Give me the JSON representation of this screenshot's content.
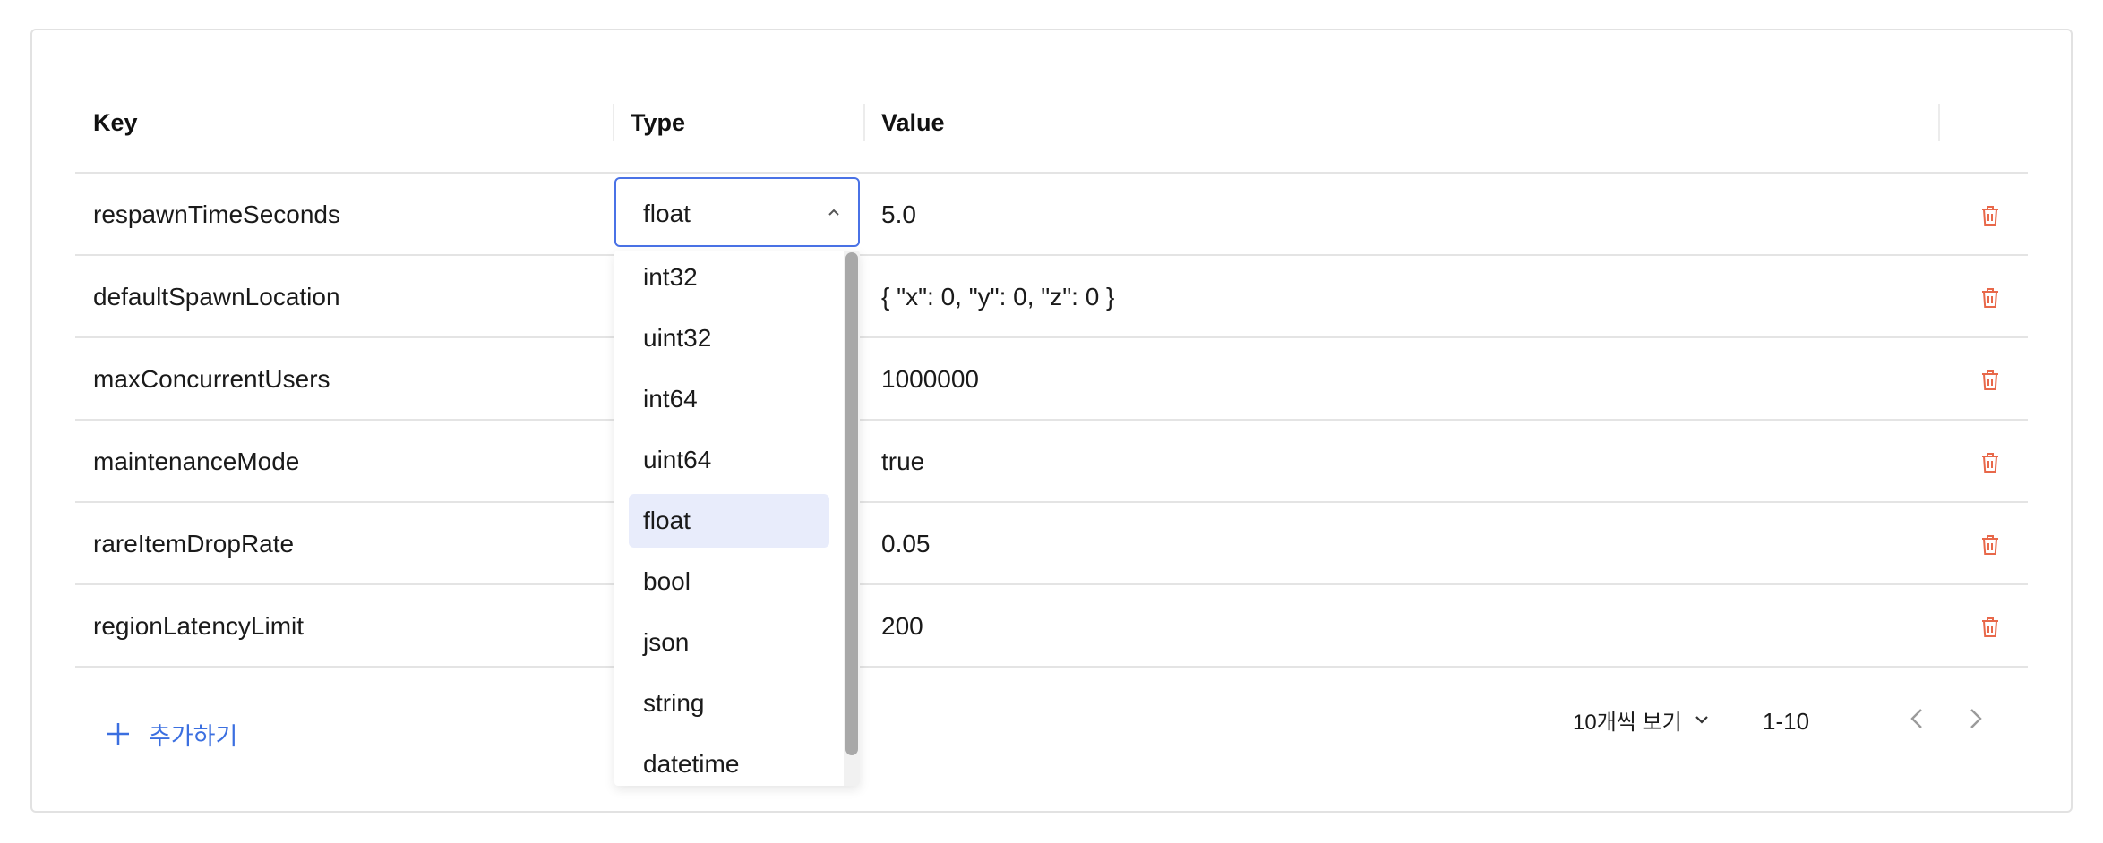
{
  "table": {
    "headers": {
      "key": "Key",
      "type": "Type",
      "value": "Value"
    },
    "rows": [
      {
        "key": "respawnTimeSeconds",
        "value": "5.0"
      },
      {
        "key": "defaultSpawnLocation",
        "value": "{ \"x\": 0, \"y\": 0, \"z\": 0 }"
      },
      {
        "key": "maxConcurrentUsers",
        "value": "1000000"
      },
      {
        "key": "maintenanceMode",
        "value": "true"
      },
      {
        "key": "rareItemDropRate",
        "value": "0.05"
      },
      {
        "key": "regionLatencyLimit",
        "value": "200"
      }
    ]
  },
  "type_select": {
    "selected": "float",
    "options": [
      "int32",
      "uint32",
      "int64",
      "uint64",
      "float",
      "bool",
      "json",
      "string",
      "datetime"
    ]
  },
  "footer": {
    "add_label": "추가하기",
    "page_size_label": "10개씩 보기",
    "range_label": "1-10"
  },
  "colors": {
    "accent": "#3b6fe0",
    "delete": "#e8684a",
    "selected_option_bg": "#e8ecfb"
  }
}
